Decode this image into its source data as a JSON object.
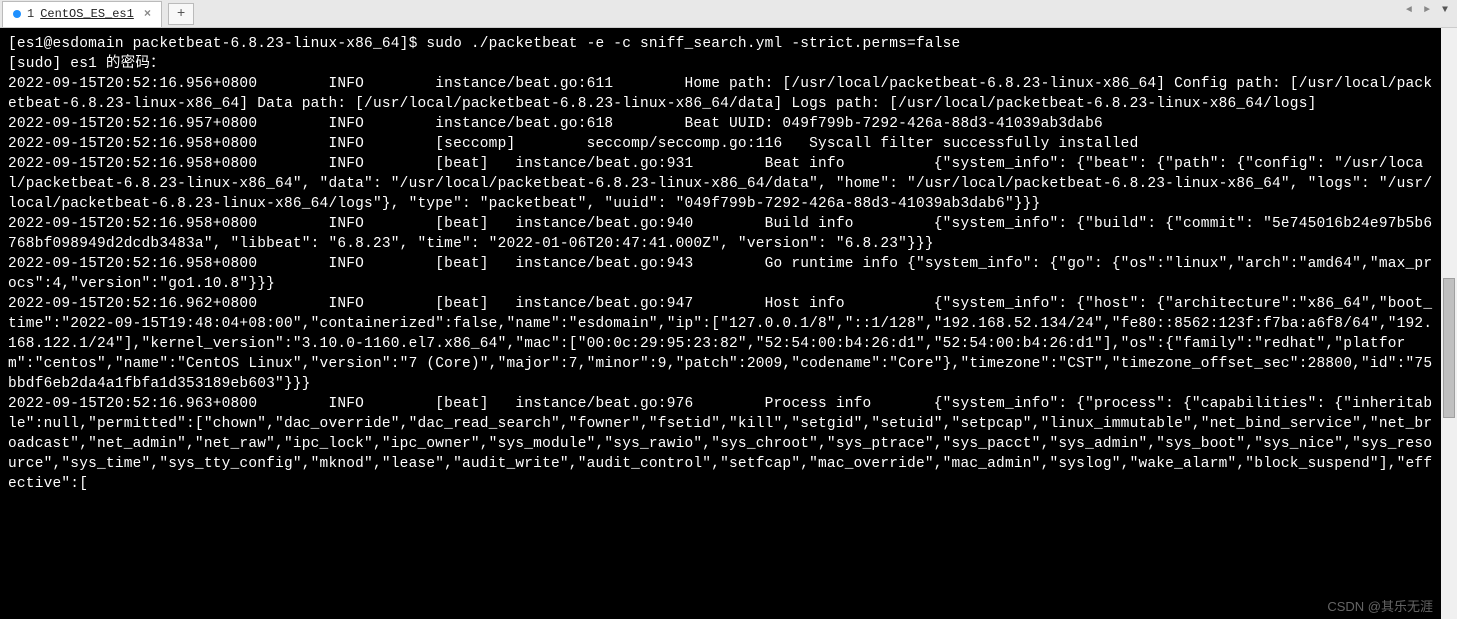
{
  "tab": {
    "index": "1",
    "title": "CentOS_ES_es1",
    "close": "×"
  },
  "newtab_label": "+",
  "nav": {
    "left": "◄",
    "right": "►",
    "menu": "▼"
  },
  "terminal": {
    "prompt": "[es1@esdomain packetbeat-6.8.23-linux-x86_64]$ ",
    "command": "sudo ./packetbeat -e -c sniff_search.yml -strict.perms=false",
    "sudo_line": "[sudo] es1 的密码：",
    "lines": [
      "2022-09-15T20:52:16.956+0800        INFO        instance/beat.go:611        Home path: [/usr/local/packetbeat-6.8.23-linux-x86_64] Config path: [/usr/local/packetbeat-6.8.23-linux-x86_64] Data path: [/usr/local/packetbeat-6.8.23-linux-x86_64/data] Logs path: [/usr/local/packetbeat-6.8.23-linux-x86_64/logs]",
      "2022-09-15T20:52:16.957+0800        INFO        instance/beat.go:618        Beat UUID: 049f799b-7292-426a-88d3-41039ab3dab6",
      "2022-09-15T20:52:16.958+0800        INFO        [seccomp]        seccomp/seccomp.go:116   Syscall filter successfully installed",
      "2022-09-15T20:52:16.958+0800        INFO        [beat]   instance/beat.go:931        Beat info          {\"system_info\": {\"beat\": {\"path\": {\"config\": \"/usr/local/packetbeat-6.8.23-linux-x86_64\", \"data\": \"/usr/local/packetbeat-6.8.23-linux-x86_64/data\", \"home\": \"/usr/local/packetbeat-6.8.23-linux-x86_64\", \"logs\": \"/usr/local/packetbeat-6.8.23-linux-x86_64/logs\"}, \"type\": \"packetbeat\", \"uuid\": \"049f799b-7292-426a-88d3-41039ab3dab6\"}}}",
      "2022-09-15T20:52:16.958+0800        INFO        [beat]   instance/beat.go:940        Build info         {\"system_info\": {\"build\": {\"commit\": \"5e745016b24e97b5b6768bf098949d2dcdb3483a\", \"libbeat\": \"6.8.23\", \"time\": \"2022-01-06T20:47:41.000Z\", \"version\": \"6.8.23\"}}}",
      "2022-09-15T20:52:16.958+0800        INFO        [beat]   instance/beat.go:943        Go runtime info {\"system_info\": {\"go\": {\"os\":\"linux\",\"arch\":\"amd64\",\"max_procs\":4,\"version\":\"go1.10.8\"}}}",
      "2022-09-15T20:52:16.962+0800        INFO        [beat]   instance/beat.go:947        Host info          {\"system_info\": {\"host\": {\"architecture\":\"x86_64\",\"boot_time\":\"2022-09-15T19:48:04+08:00\",\"containerized\":false,\"name\":\"esdomain\",\"ip\":[\"127.0.0.1/8\",\"::1/128\",\"192.168.52.134/24\",\"fe80::8562:123f:f7ba:a6f8/64\",\"192.168.122.1/24\"],\"kernel_version\":\"3.10.0-1160.el7.x86_64\",\"mac\":[\"00:0c:29:95:23:82\",\"52:54:00:b4:26:d1\",\"52:54:00:b4:26:d1\"],\"os\":{\"family\":\"redhat\",\"platform\":\"centos\",\"name\":\"CentOS Linux\",\"version\":\"7 (Core)\",\"major\":7,\"minor\":9,\"patch\":2009,\"codename\":\"Core\"},\"timezone\":\"CST\",\"timezone_offset_sec\":28800,\"id\":\"75bbdf6eb2da4a1fbfa1d353189eb603\"}}}",
      "2022-09-15T20:52:16.963+0800        INFO        [beat]   instance/beat.go:976        Process info       {\"system_info\": {\"process\": {\"capabilities\": {\"inheritable\":null,\"permitted\":[\"chown\",\"dac_override\",\"dac_read_search\",\"fowner\",\"fsetid\",\"kill\",\"setgid\",\"setuid\",\"setpcap\",\"linux_immutable\",\"net_bind_service\",\"net_broadcast\",\"net_admin\",\"net_raw\",\"ipc_lock\",\"ipc_owner\",\"sys_module\",\"sys_rawio\",\"sys_chroot\",\"sys_ptrace\",\"sys_pacct\",\"sys_admin\",\"sys_boot\",\"sys_nice\",\"sys_resource\",\"sys_time\",\"sys_tty_config\",\"mknod\",\"lease\",\"audit_write\",\"audit_control\",\"setfcap\",\"mac_override\",\"mac_admin\",\"syslog\",\"wake_alarm\",\"block_suspend\"],\"effective\":["
    ]
  },
  "watermark": "CSDN @其乐无涯"
}
